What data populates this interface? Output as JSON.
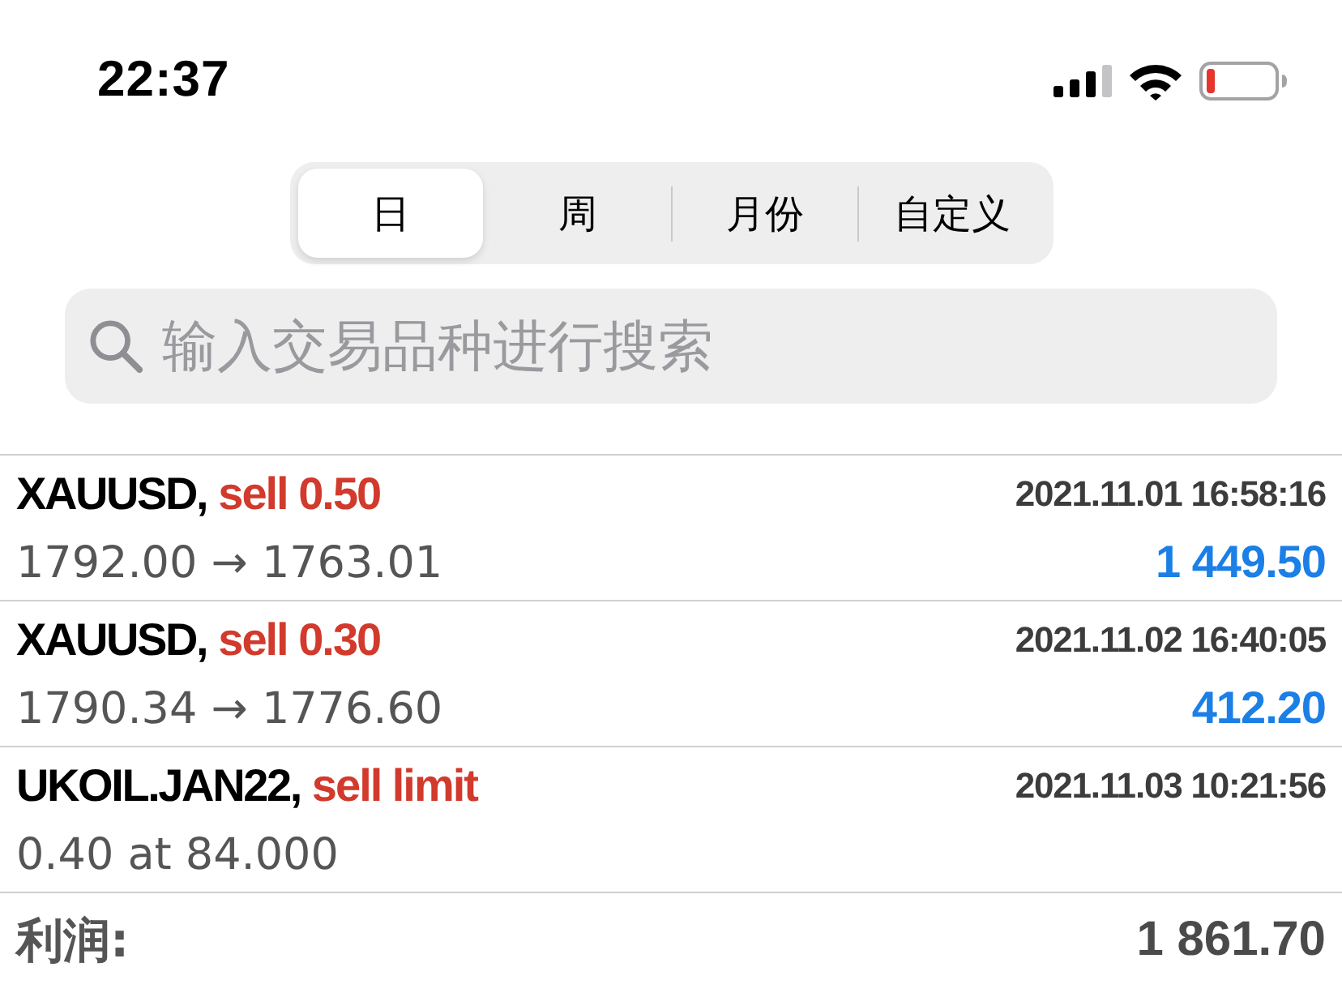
{
  "status_bar": {
    "time": "22:37"
  },
  "period_tabs": [
    {
      "label": "日",
      "selected": true
    },
    {
      "label": "周",
      "selected": false
    },
    {
      "label": "月份",
      "selected": false
    },
    {
      "label": "自定义",
      "selected": false
    }
  ],
  "search": {
    "placeholder": "输入交易品种进行搜索"
  },
  "orders": [
    {
      "symbol": "XAUUSD,",
      "action": "sell 0.50",
      "time": "2021.11.01 16:58:16",
      "details": "1792.00 → 1763.01",
      "profit": "1 449.50"
    },
    {
      "symbol": "XAUUSD,",
      "action": "sell 0.30",
      "time": "2021.11.02 16:40:05",
      "details": "1790.34 → 1776.60",
      "profit": "412.20"
    },
    {
      "symbol": "UKOIL.JAN22,",
      "action": "sell limit",
      "time": "2021.11.03 10:21:56",
      "details": "0.40 at 84.000"
    }
  ],
  "summary": [
    {
      "label": "利润:",
      "value": "1 861.70"
    }
  ]
}
